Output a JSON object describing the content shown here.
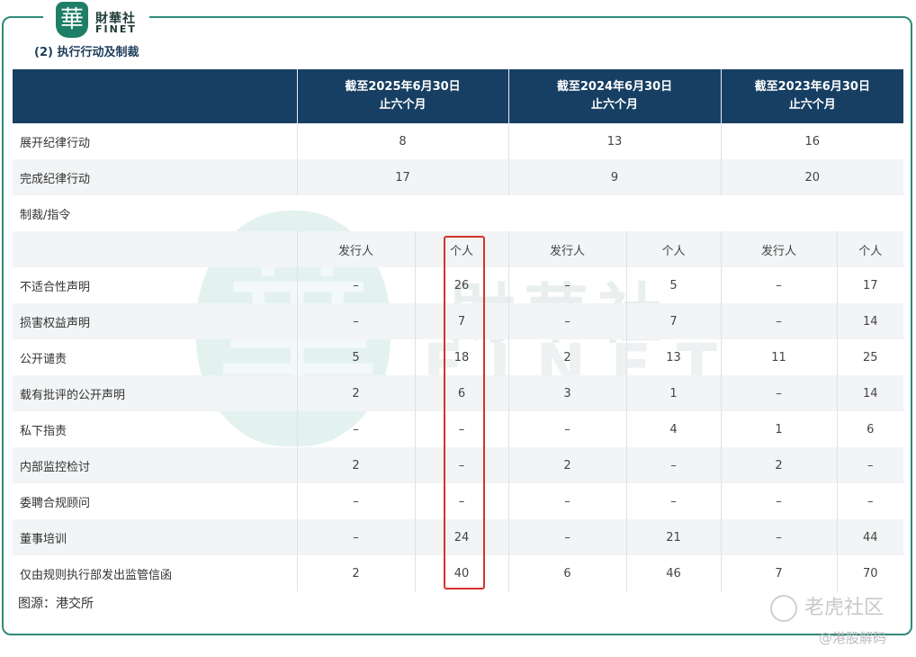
{
  "brand": {
    "glyph": "華",
    "name_cn": "財華社",
    "name_en": "FINET"
  },
  "subtitle": "(2) 执行行动及制裁",
  "header": {
    "periods": [
      {
        "line1": "截至2025年6月30日",
        "line2": "止六个月"
      },
      {
        "line1": "截至2024年6月30日",
        "line2": "止六个月"
      },
      {
        "line1": "截至2023年6月30日",
        "line2": "止六个月"
      }
    ]
  },
  "summary_rows": [
    {
      "label": "展开纪律行动",
      "values": [
        "8",
        "13",
        "16"
      ]
    },
    {
      "label": "完成纪律行动",
      "values": [
        "17",
        "9",
        "20"
      ]
    }
  ],
  "section_label": "制裁/指令",
  "sub_headers": [
    "发行人",
    "个人",
    "发行人",
    "个人",
    "发行人",
    "个人"
  ],
  "sanction_rows": [
    {
      "label": "不适合性声明",
      "values": [
        "–",
        "26",
        "–",
        "5",
        "–",
        "17"
      ]
    },
    {
      "label": "损害权益声明",
      "values": [
        "–",
        "7",
        "–",
        "7",
        "–",
        "14"
      ]
    },
    {
      "label": "公开谴责",
      "values": [
        "5",
        "18",
        "2",
        "13",
        "11",
        "25"
      ]
    },
    {
      "label": "载有批评的公开声明",
      "values": [
        "2",
        "6",
        "3",
        "1",
        "–",
        "14"
      ]
    },
    {
      "label": "私下指责",
      "values": [
        "–",
        "–",
        "–",
        "4",
        "1",
        "6"
      ]
    },
    {
      "label": "内部监控检讨",
      "values": [
        "2",
        "–",
        "2",
        "–",
        "2",
        "–"
      ]
    },
    {
      "label": "委聘合规顾问",
      "values": [
        "–",
        "–",
        "–",
        "–",
        "–",
        "–"
      ]
    },
    {
      "label": "董事培训",
      "values": [
        "–",
        "24",
        "–",
        "21",
        "–",
        "44"
      ]
    },
    {
      "label": "仅由规则执行部发出监管信函",
      "values": [
        "2",
        "40",
        "6",
        "46",
        "7",
        "70"
      ]
    }
  ],
  "source": "图源：港交所",
  "footer_brand": "老虎社区",
  "footer_author": "@港股解码",
  "colors": {
    "header_bg": "#173f63",
    "frame": "#2f8a78",
    "highlight": "#d6332a",
    "alt_row": "#f2f4f6"
  }
}
